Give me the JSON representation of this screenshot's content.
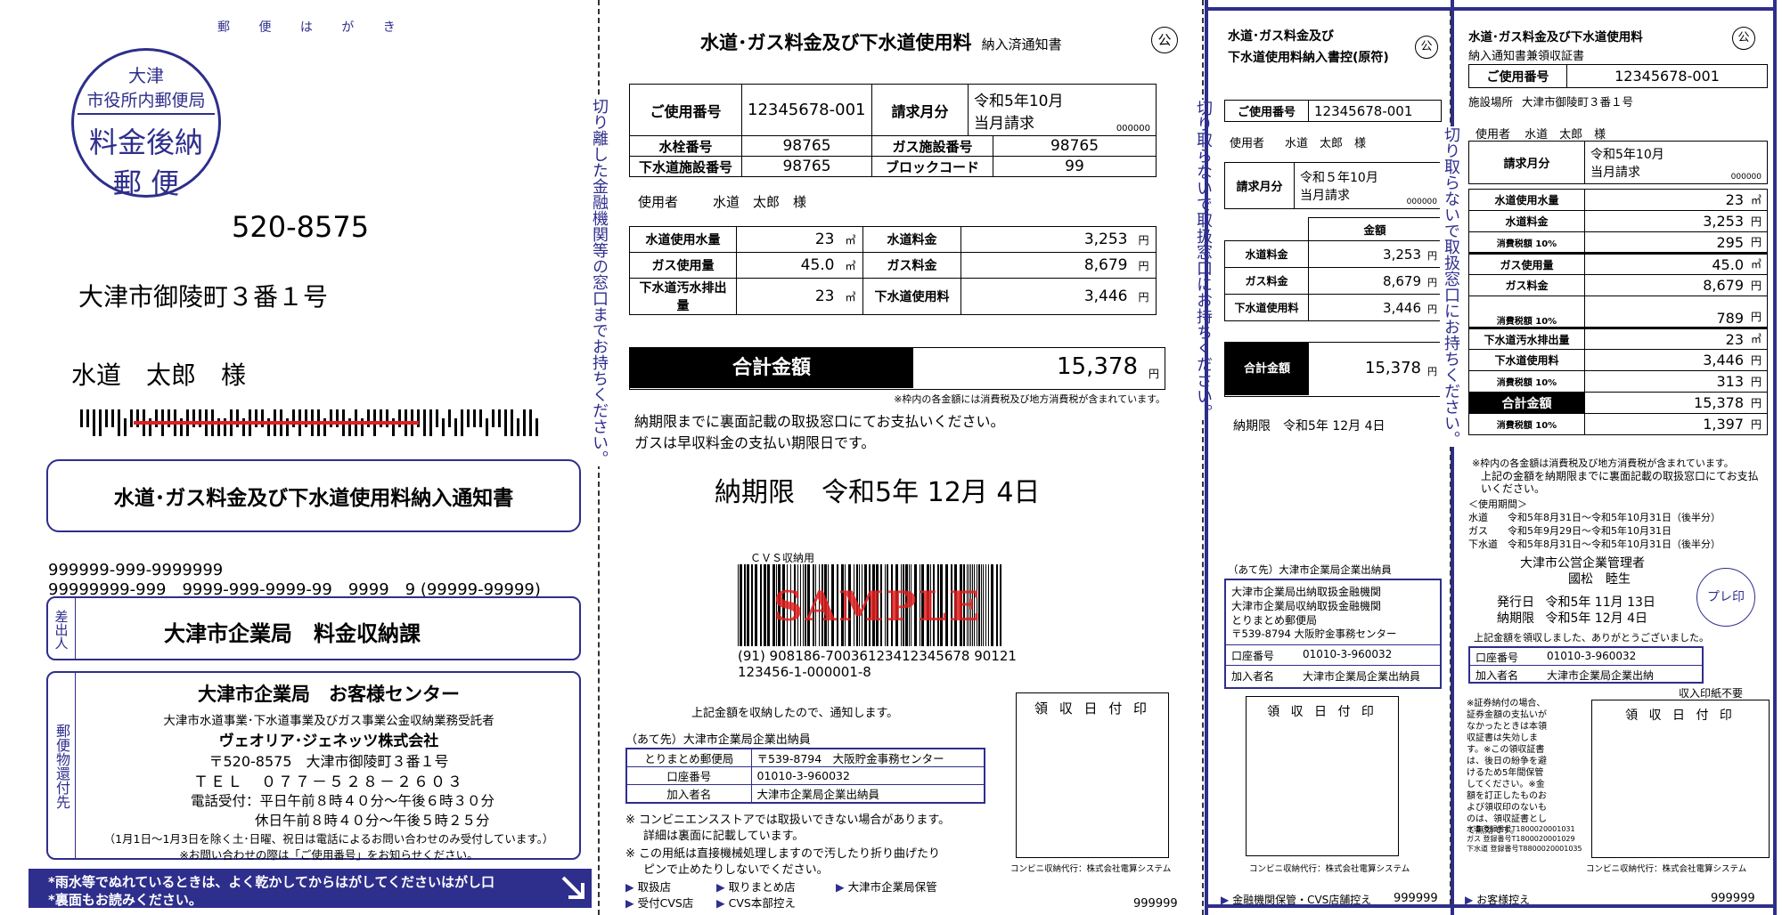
{
  "colors": {
    "navy": "#2e2e8c",
    "black": "#000000",
    "red_mark": "#e02020"
  },
  "panel1": {
    "postcard_label": "郵 便 は が き",
    "stamp": {
      "line1": "大津",
      "line2": "市役所内郵便局",
      "line3": "料金後納",
      "line4": "郵 便"
    },
    "postal_code": "520-8575",
    "address": "大津市御陵町３番１号",
    "recipient": "水道　太郎　様",
    "notice_title": "水道･ガス料金及び下水道使用料納入通知書",
    "code_line1": "999999-999-9999999",
    "code_line2": "99999999-999　9999-999-9999-99　9999　9 (99999-99999)",
    "sender_label": "差出人",
    "sender_name": "大津市企業局　料金収納課",
    "return_label": "郵便物還付先",
    "return_title": "大津市企業局　お客様センター",
    "return_sub": "大津市水道事業･下水道事業及びガス事業公金収納業務受託者",
    "return_company": "ヴェオリア･ジェネッツ株式会社",
    "return_address": "〒520-8575　大津市御陵町３番１号",
    "return_tel": "ＴＥＬ　０７７－５２８－２６０３",
    "hours1": "電話受付：平日午前８時４０分～午後６時３０分",
    "hours2": "休日午前８時４０分～午後５時２５分",
    "holiday_note": "（1月1日～1月3日を除く土･日曜、祝日は電話によるお問い合わせのみ受付しています。）",
    "inquiry_note": "※お問い合わせの際は「ご使用番号」をお知らせください。",
    "bottom_note1": "*雨水等でぬれているときは、よく乾かしてからはがしてくださいはがし口",
    "bottom_note2": "*裏面もお読みください。"
  },
  "cut_note1": "切り離した金融機関等の窓口までお持ちください。",
  "panel2": {
    "title": "水道･ガス料金及び下水道使用料",
    "subtitle": "納入済通知書",
    "public_mark": "公",
    "usage_no_label": "ご使用番号",
    "usage_no": "12345678-001",
    "billing_month_label": "請求月分",
    "billing_month": "令和5年10月",
    "billing_current": "当月請求",
    "billing_code": "000000",
    "meter_label": "水栓番号",
    "meter_no": "98765",
    "gas_facility_label": "ガス施設番号",
    "gas_facility_no": "98765",
    "sewer_facility_label": "下水道施設番号",
    "sewer_facility_no": "98765",
    "block_label": "ブロックコード",
    "block_code": "99",
    "user_label": "使用者",
    "user_name": "水道　太郎　様",
    "rows": [
      {
        "l1": "水道使用水量",
        "v1": "23",
        "u1": "㎥",
        "l2": "水道料金",
        "v2": "3,253",
        "u2": "円"
      },
      {
        "l1": "ガス使用量",
        "v1": "45.0",
        "u1": "㎥",
        "l2": "ガス料金",
        "v2": "8,679",
        "u2": "円"
      },
      {
        "l1": "下水道汚水排出量",
        "v1": "23",
        "u1": "㎥",
        "l2": "下水道使用料",
        "v2": "3,446",
        "u2": "円"
      }
    ],
    "total_label": "合計金額",
    "total_value": "15,378",
    "yen": "円",
    "tax_note": "※枠内の各金額には消費税及び地方消費税が含まれています。",
    "pay_note1": "納期限までに裏面記載の取扱窓口にてお支払いください。",
    "pay_note2": "ガスは早収料金の支払い期限日です。",
    "deadline": "納期限　令和5年 12月 4日",
    "cvs_label": "ＣＶＳ収納用",
    "sample": "SAMPLE",
    "barcode_line1": "(91) 908186-70036123412345678 90121",
    "barcode_line2": "123456-1-000001-8",
    "received_note": "上記金額を収納したので、通知します。",
    "addressee": "（あて先）大津市企業局企業出納員",
    "bank_table": [
      {
        "k": "とりまとめ郵便局",
        "v": "〒539-8794　大阪貯金事務センター"
      },
      {
        "k": "口座番号",
        "v": "01010-3-960032"
      },
      {
        "k": "加入者名",
        "v": "大津市企業局企業出納員"
      }
    ],
    "note_cvs": "※ コンビニエンスストアでは取扱いできない場合があります。",
    "note_cvs2": "詳細は裏面に記載しています。",
    "note_machine": "※ この用紙は直接機械処理しますので汚したり折り曲げたり",
    "note_machine2": "ピンで止めたりしないでください。",
    "stamp_box": "領 収 日 付 印",
    "cvs_agent": "コンビニ収納代行：株式会社電算システム",
    "legend": [
      "取扱店",
      "取りまとめ店",
      "大津市企業局保管",
      "受付CVS店",
      "CVS本部控え"
    ],
    "serial": "999999"
  },
  "cut_note2": "切り取らないで取扱窓口にお持ちください。",
  "panel3": {
    "title": "水道･ガス料金及び",
    "title2": "下水道使用料納入書控(原符)",
    "public_mark": "公",
    "usage_no_label": "ご使用番号",
    "usage_no": "12345678-001",
    "user_label": "使用者",
    "user_name": "水道　太郎　様",
    "billing_month_label": "請求月分",
    "billing_month": "令和５年10月",
    "billing_current": "当月請求",
    "billing_code": "000000",
    "amount_header": "金額",
    "rows": [
      {
        "label": "水道料金",
        "value": "3,253",
        "unit": "円"
      },
      {
        "label": "ガス料金",
        "value": "8,679",
        "unit": "円"
      },
      {
        "label": "下水道使用料",
        "value": "3,446",
        "unit": "円"
      }
    ],
    "total_label": "合計金額",
    "total_value": "15,378",
    "yen": "円",
    "deadline": "納期限　令和5年 12月 4日",
    "addressee": "（あて先）大津市企業局企業出納員",
    "bank_lines": [
      "大津市企業局出納取扱金融機関",
      "大津市企業局収納取扱金融機関",
      "とりまとめ郵便局",
      "〒539-8794 大阪貯金事務センター"
    ],
    "account_label": "口座番号",
    "account_no": "01010-3-960032",
    "subscriber_label": "加入者名",
    "subscriber": "大津市企業局企業出納員",
    "stamp_box": "領 収 日 付 印",
    "cvs_agent": "コンビニ収納代行：株式会社電算システム",
    "footer": "金融機関保管・CVS店舗控え",
    "serial": "999999"
  },
  "cut_note3": "切り取らないで取扱窓口にお持ちください。",
  "panel4": {
    "title": "水道･ガス料金及び下水道使用料",
    "subtitle": "納入通知書兼領収証書",
    "public_mark": "公",
    "usage_no_label": "ご使用番号",
    "usage_no": "12345678-001",
    "facility_label": "施設場所",
    "facility": "大津市御陵町３番１号",
    "user_label": "使用者",
    "user_name": "水道　太郎　様",
    "billing_month_label": "請求月分",
    "billing_month": "令和5年10月",
    "billing_current": "当月請求",
    "billing_code": "000000",
    "rows": [
      {
        "label": "水道使用水量",
        "value": "23",
        "unit": "㎥"
      },
      {
        "label": "水道料金",
        "value": "3,253",
        "unit": "円"
      },
      {
        "label": "消費税額 10%",
        "value": "295",
        "unit": "円"
      },
      {
        "label": "ガス使用量",
        "value": "45.0",
        "unit": "㎥"
      },
      {
        "label": "ガス料金",
        "value": "8,679",
        "unit": "円"
      },
      {
        "label": "消費税額 10%",
        "value": "789",
        "unit": "円"
      },
      {
        "label": "下水道汚水排出量",
        "value": "23",
        "unit": "㎥"
      },
      {
        "label": "下水道使用料",
        "value": "3,446",
        "unit": "円"
      },
      {
        "label": "消費税額 10%",
        "value": "313",
        "unit": "円"
      },
      {
        "label": "合計金額",
        "value": "15,378",
        "unit": "円"
      },
      {
        "label": "消費税額 10%",
        "value": "1,397",
        "unit": "円"
      }
    ],
    "tax_note": "※枠内の各金額は消費税及び地方消費税が含まれています。",
    "pay_note": "上記の金額を納期限までに裏面記載の取扱窓口にてお支払いください。",
    "period_label": "＜使用期間＞",
    "periods": [
      {
        "k": "水道",
        "v": "令和5年8月31日～令和5年10月31日（後半分）"
      },
      {
        "k": "ガス",
        "v": "令和5年9月29日～令和5年10月31日"
      },
      {
        "k": "下水道",
        "v": "令和5年8月31日～令和5年10月31日（後半分）"
      }
    ],
    "manager": "大津市公営企業管理者",
    "manager_name": "國松　睦生",
    "issue_label": "発行日",
    "issue_date": "令和5年 11月 13日",
    "due_label": "納期限",
    "due_date": "令和5年 12月 4日",
    "seal": "プレ印",
    "received_note": "上記金額を領収しました、ありがとうございました。",
    "account_label": "口座番号",
    "account_no": "01010-3-960032",
    "subscriber_label": "加入者名",
    "subscriber": "大津市企業局企業出納",
    "stamp_free": "収入印紙不要",
    "small_note": "※証券納付の場合、証券金額の支払いがなかったときは本領収証書は失効します。※この領収証書は、後日の紛争を避けるため5年間保管してください。※金額を訂正したものおよび領収印のないものは、領収証書として無効です。",
    "reg": [
      "水道 登録番号T1800020001031",
      "ガス 登録番号T1800020001029",
      "下水道 登録番号T8800020001035"
    ],
    "stamp_box": "領 収 日 付 印",
    "cvs_agent": "コンビニ収納代行：株式会社電算システム",
    "footer": "お客様控え",
    "serial": "999999"
  }
}
